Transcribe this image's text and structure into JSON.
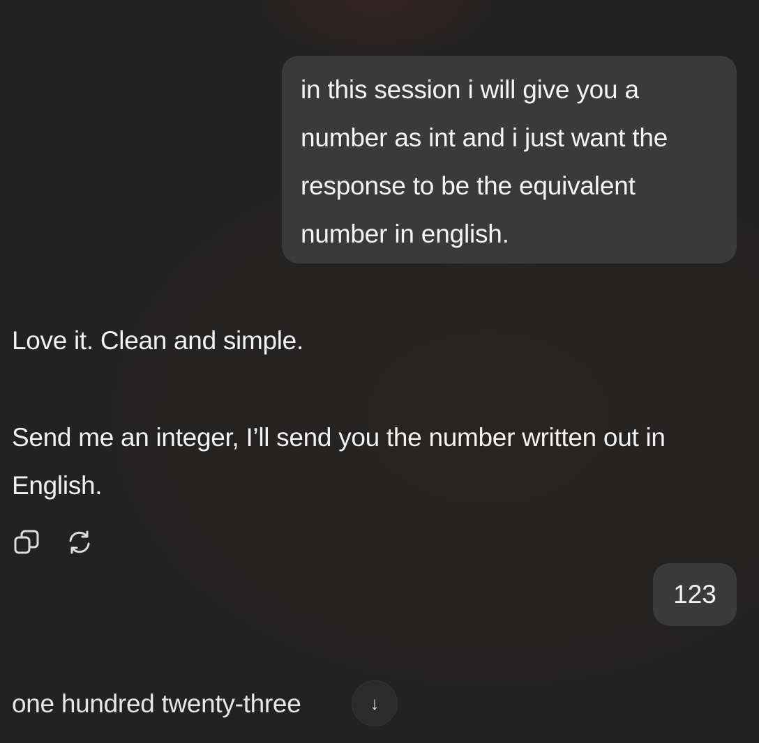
{
  "conversation": {
    "user_message_1": "in this session i will give you a number as int and i just want the response to be the equivalent number in english.",
    "assistant_message_1": {
      "paragraph_1": "Love it. Clean and simple.",
      "paragraph_2": "Send me an integer, I’ll send you the number written out in English."
    },
    "user_message_2": "123",
    "assistant_message_2": "one hundred twenty-three"
  },
  "actions": {
    "copy_icon": "copy-icon",
    "regenerate_icon": "regenerate-icon"
  },
  "scroll_button": {
    "icon": "arrow-down-icon",
    "glyph": "↓"
  },
  "colors": {
    "background": "#222222",
    "user_bubble": "#3a3a3a",
    "text": "#f2f2f2"
  }
}
